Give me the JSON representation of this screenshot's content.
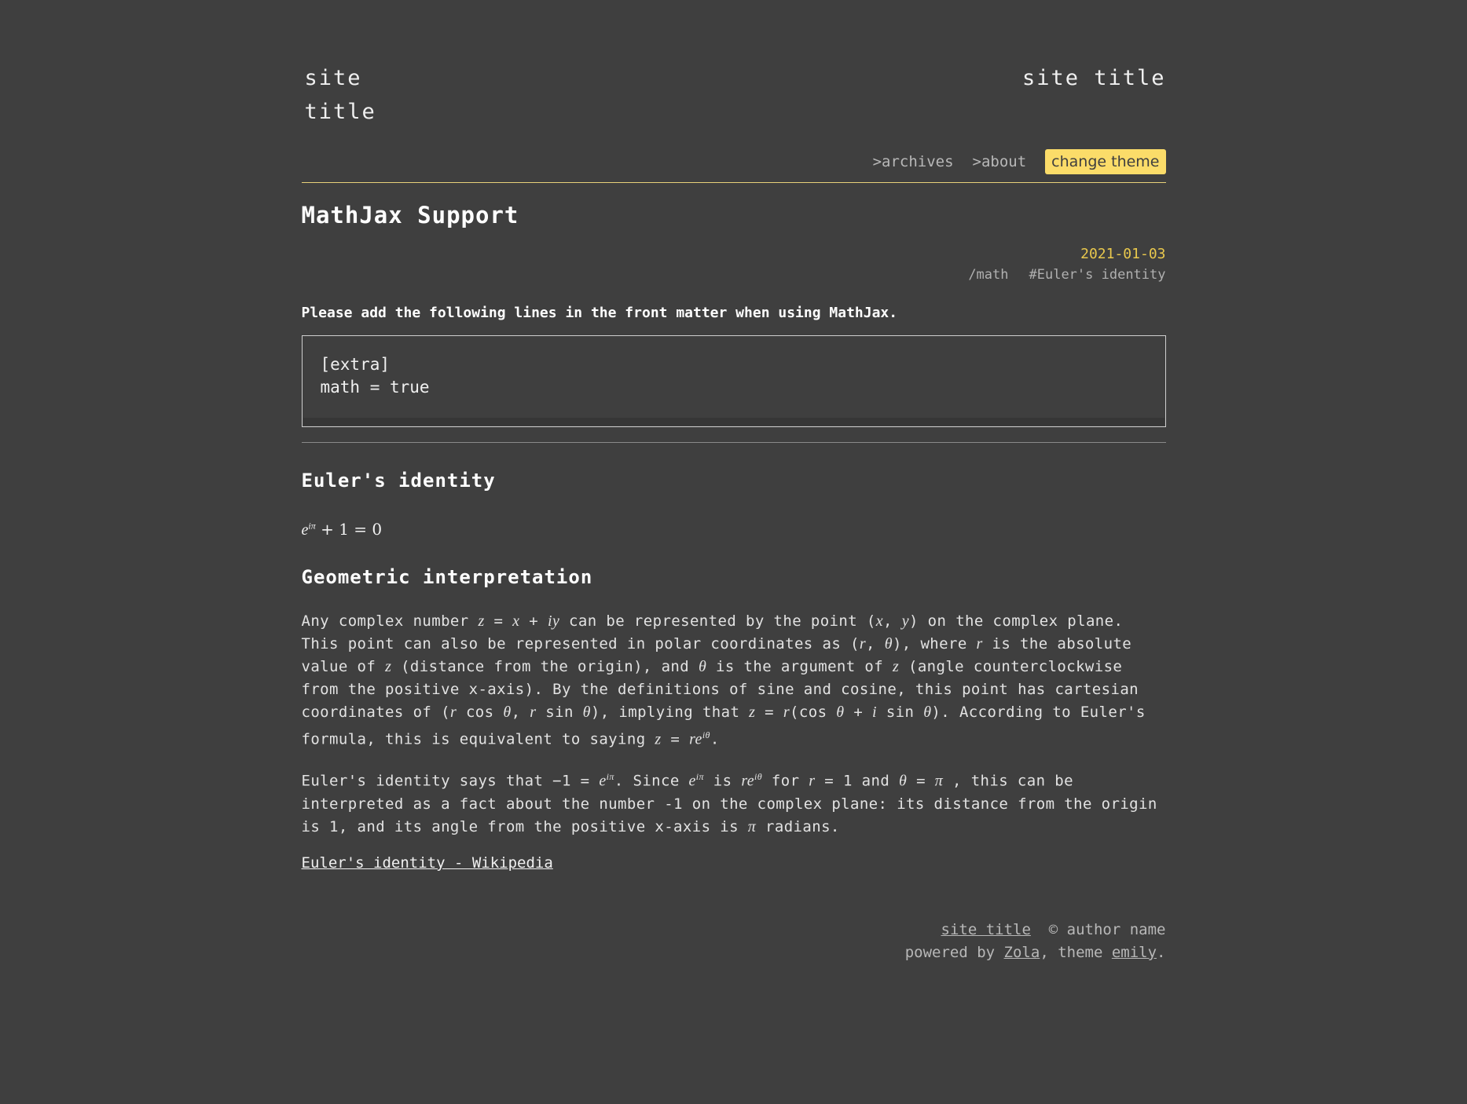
{
  "header": {
    "site_title_left": "site title",
    "site_title_right": "site title",
    "nav": {
      "archives": ">archives",
      "about": ">about",
      "change_theme": "change theme"
    }
  },
  "post": {
    "title": "MathJax Support",
    "date": "2021-01-03",
    "category": "/math",
    "tag": "#Euler's identity",
    "intro": "Please add the following lines in the front matter when using MathJax.",
    "code_line1": "[extra]",
    "code_line2": "math = true",
    "h2_euler": "Euler's identity",
    "h2_geometric": "Geometric interpretation",
    "wiki_link": "Euler's identity - Wikipedia"
  },
  "footer": {
    "site_title": "site title",
    "copyright": "© author name",
    "powered_by": "powered by",
    "zola": "Zola",
    "theme_text": ", theme",
    "emily": "emily",
    "period": "."
  },
  "colors": {
    "background": "#3f3f3f",
    "accent": "#fbdc69",
    "date": "#e9c84d"
  }
}
